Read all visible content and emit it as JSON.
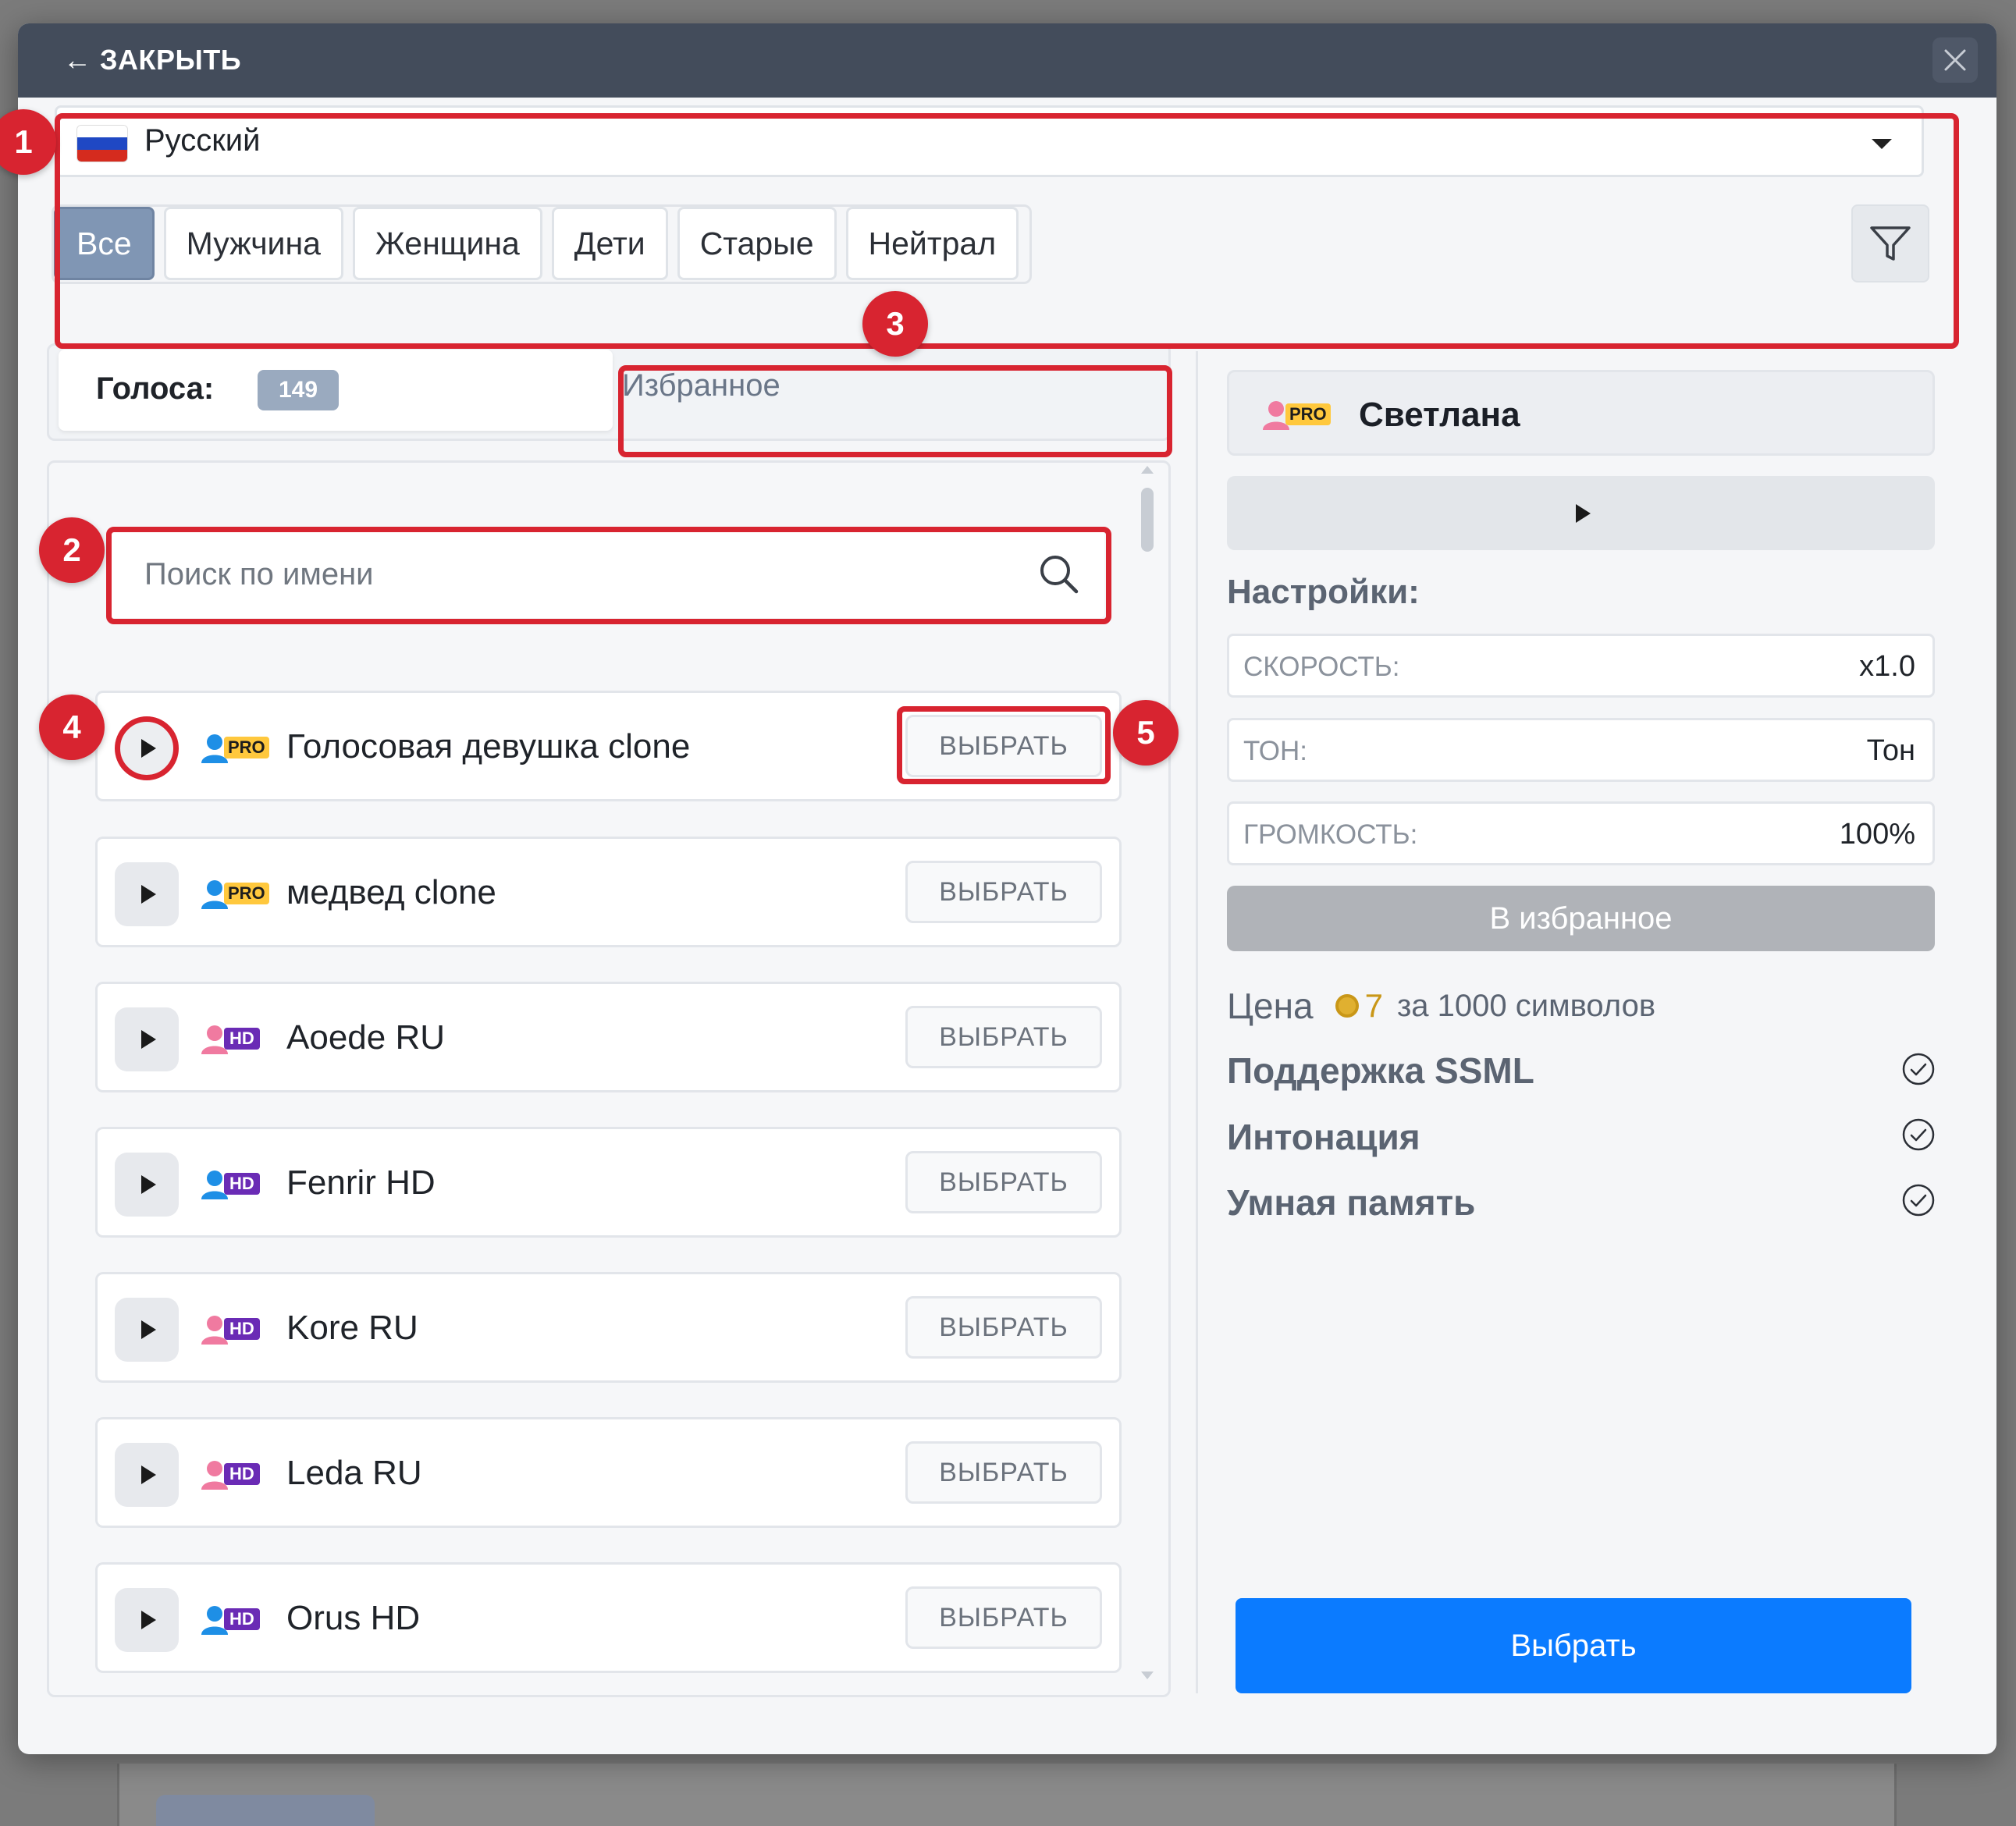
{
  "header": {
    "back_label": "← ЗАКРЫТЬ"
  },
  "annotations": [
    "1",
    "2",
    "3",
    "4",
    "5"
  ],
  "language": {
    "selected": "Русский"
  },
  "filters": [
    {
      "label": "Все",
      "active": true
    },
    {
      "label": "Мужчина",
      "active": false
    },
    {
      "label": "Женщина",
      "active": false
    },
    {
      "label": "Дети",
      "active": false
    },
    {
      "label": "Старые",
      "active": false
    },
    {
      "label": "Нейтрал",
      "active": false
    }
  ],
  "tabs": {
    "voices_label": "Голоса:",
    "voices_count": "149",
    "favorites_label": "Избранное"
  },
  "search": {
    "placeholder": "Поиск по имени"
  },
  "select_label": "ВЫБРАТЬ",
  "voices": [
    {
      "name": "Голосовая девушка clone",
      "gender": "male",
      "tier": "PRO"
    },
    {
      "name": "медвед clone",
      "gender": "male",
      "tier": "PRO"
    },
    {
      "name": "Aoede RU",
      "gender": "female",
      "tier": "HD"
    },
    {
      "name": "Fenrir HD",
      "gender": "male",
      "tier": "HD"
    },
    {
      "name": "Kore RU",
      "gender": "female",
      "tier": "HD"
    },
    {
      "name": "Leda RU",
      "gender": "female",
      "tier": "HD"
    },
    {
      "name": "Orus HD",
      "gender": "male",
      "tier": "HD"
    }
  ],
  "selected_voice": {
    "name": "Светлана",
    "tier": "PRO"
  },
  "settings": {
    "title": "Настройки:",
    "speed_label": "СКОРОСТЬ:",
    "speed_value": "x1.0",
    "tone_label": "ТОН:",
    "tone_value": "Тон",
    "volume_label": "ГРОМКОСТЬ:",
    "volume_value": "100%"
  },
  "favorite_button": "В избранное",
  "price": {
    "label": "Цена",
    "amount": "7",
    "suffix": "за 1000 символов"
  },
  "features": [
    "Поддержка SSML",
    "Интонация",
    "Умная память"
  ],
  "choose_button": "Выбрать",
  "colors": {
    "accent": "#0b7bff",
    "annotation": "#d82430",
    "pro": "#ffc83d",
    "hd": "#6a2bb5",
    "male": "#1e8fe6",
    "female": "#f07aa0"
  }
}
